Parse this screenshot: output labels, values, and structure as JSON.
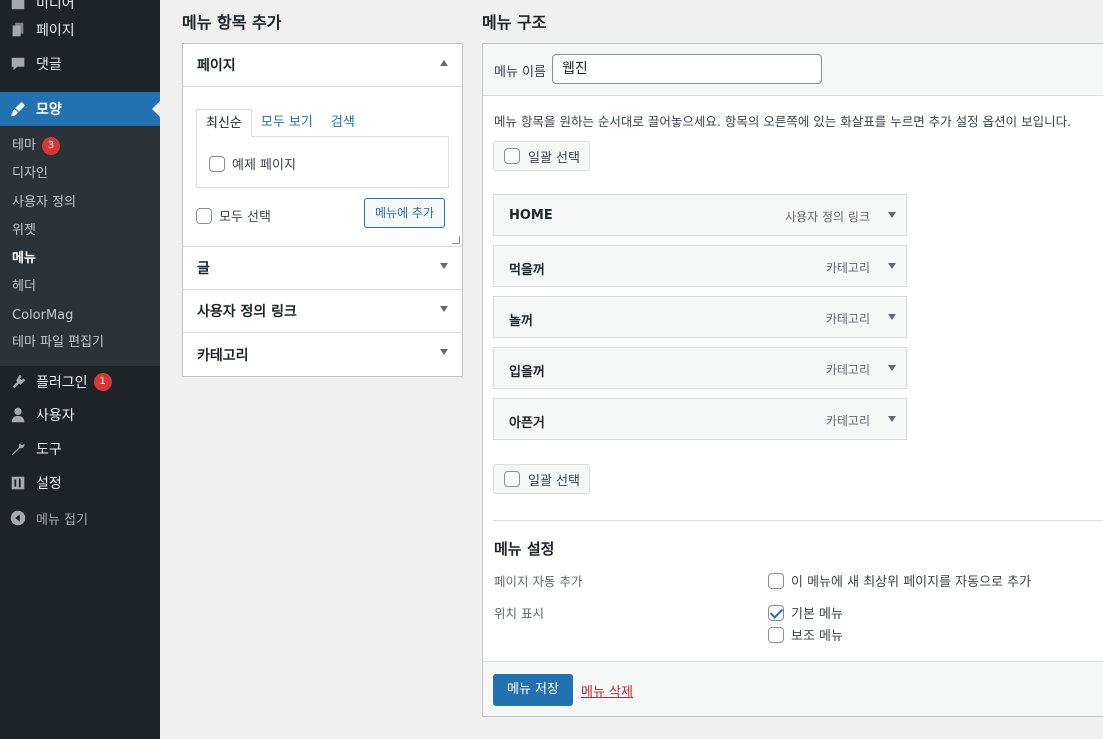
{
  "sidebar": {
    "top_partial": "미디어",
    "items": [
      {
        "label": "페이지",
        "icon": "pages-icon"
      },
      {
        "label": "댓글",
        "icon": "comments-icon"
      },
      {
        "label": "모양",
        "icon": "appearance-icon"
      },
      {
        "label": "플러그인",
        "icon": "plugins-icon",
        "badge": "1"
      },
      {
        "label": "사용자",
        "icon": "users-icon"
      },
      {
        "label": "도구",
        "icon": "tools-icon"
      },
      {
        "label": "설정",
        "icon": "settings-icon"
      }
    ],
    "submenu": [
      {
        "label": "테마",
        "badge": "3"
      },
      {
        "label": "디자인"
      },
      {
        "label": "사용자 정의"
      },
      {
        "label": "위젯"
      },
      {
        "label": "메뉴"
      },
      {
        "label": "헤더"
      },
      {
        "label": "ColorMag"
      },
      {
        "label": "테마 파일 편집기"
      }
    ],
    "collapse_label": "메뉴 접기"
  },
  "add_items": {
    "heading": "메뉴 항목 추가",
    "sections": [
      "페이지",
      "글",
      "사용자 정의 링크",
      "카테고리"
    ],
    "tabs": [
      "최신순",
      "모두 보기",
      "검색"
    ],
    "sample_page": "예제 페이지",
    "select_all": "모두 선택",
    "add_button": "메뉴에 추가"
  },
  "structure": {
    "heading": "메뉴 구조",
    "name_label": "메뉴 이름",
    "name_value": "웹진",
    "instructions": "메뉴 항목을 원하는 순서대로 끌어놓으세요. 항목의 오른쪽에 있는 화살표를 누르면 추가 설정 옵션이 보입니다.",
    "bulk_select": "일괄 선택",
    "items": [
      {
        "title": "HOME",
        "type": "사용자 정의 링크"
      },
      {
        "title": "먹을꺼",
        "type": "카테고리"
      },
      {
        "title": "놀꺼",
        "type": "카테고리"
      },
      {
        "title": "입을꺼",
        "type": "카테고리"
      },
      {
        "title": "아픈거",
        "type": "카테고리"
      }
    ]
  },
  "settings": {
    "title": "메뉴 설정",
    "auto_add_label": "페이지 자동 추가",
    "auto_add_option": "이 메뉴에 새 최상위 페이지를 자동으로 추가",
    "location_label": "위치 표시",
    "locations": [
      {
        "label": "기본 메뉴",
        "checked": true
      },
      {
        "label": "보조 메뉴",
        "checked": false
      }
    ]
  },
  "footer": {
    "save_button": "메뉴 저장",
    "delete_link": "메뉴 삭제"
  },
  "colors": {
    "accent": "#2271b1",
    "sidebar_bg": "#1d2327",
    "submenu_bg": "#2c3338",
    "badge": "#d63638",
    "danger": "#b32d2e"
  }
}
